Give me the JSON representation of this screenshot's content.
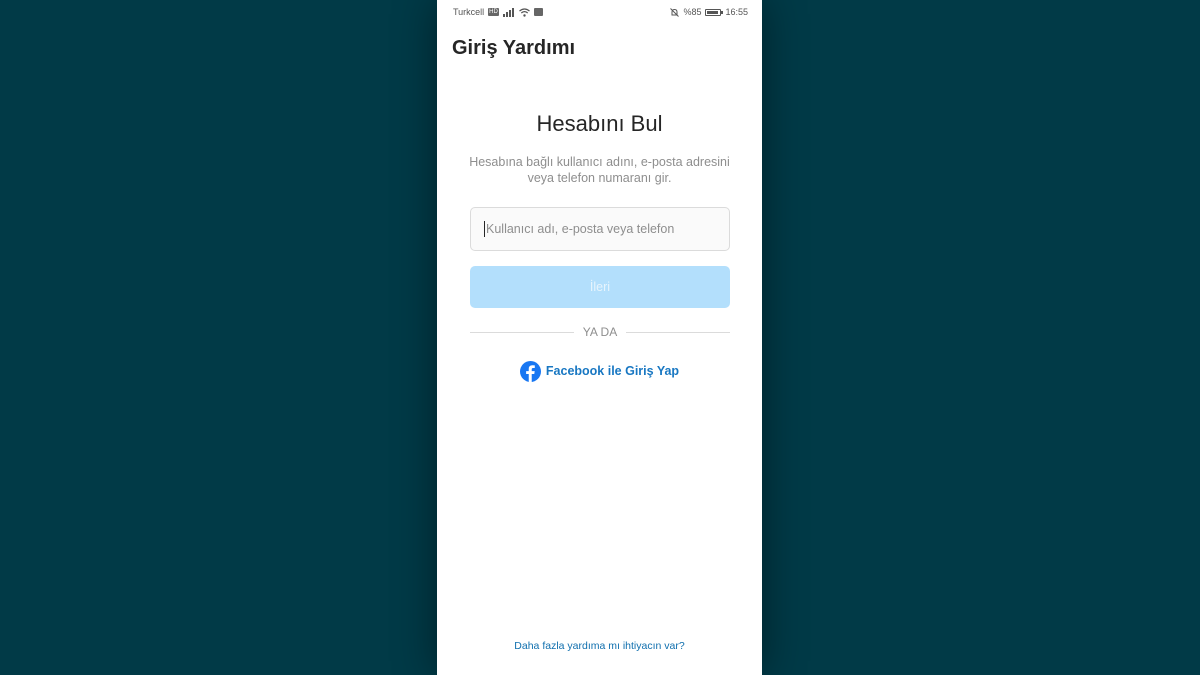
{
  "status_bar": {
    "carrier": "Turkcell",
    "network_badge": "HD",
    "mini_badge": "",
    "battery_text": "%85",
    "battery_level": 0.85,
    "time": "16:55",
    "icons": [
      "signal-icon",
      "wifi-icon",
      "notification-icon",
      "mute-icon",
      "battery-icon"
    ]
  },
  "header": {
    "title": "Giriş Yardımı"
  },
  "main": {
    "heading": "Hesabını Bul",
    "subtitle": "Hesabına bağlı kullanıcı adını, e-posta adresini veya telefon numaranı gir.",
    "input": {
      "placeholder": "Kullanıcı adı, e-posta veya telefon",
      "value": ""
    },
    "next_button": "İleri",
    "divider_text": "YA DA",
    "facebook_login": "Facebook ile Giriş Yap"
  },
  "footer": {
    "help_link": "Daha fazla yardıma mı ihtiyacın var?"
  },
  "colors": {
    "backdrop": "#013a47",
    "primary_disabled": "#b3dffc",
    "link_blue": "#1877c2",
    "facebook_blue": "#1877f2"
  }
}
